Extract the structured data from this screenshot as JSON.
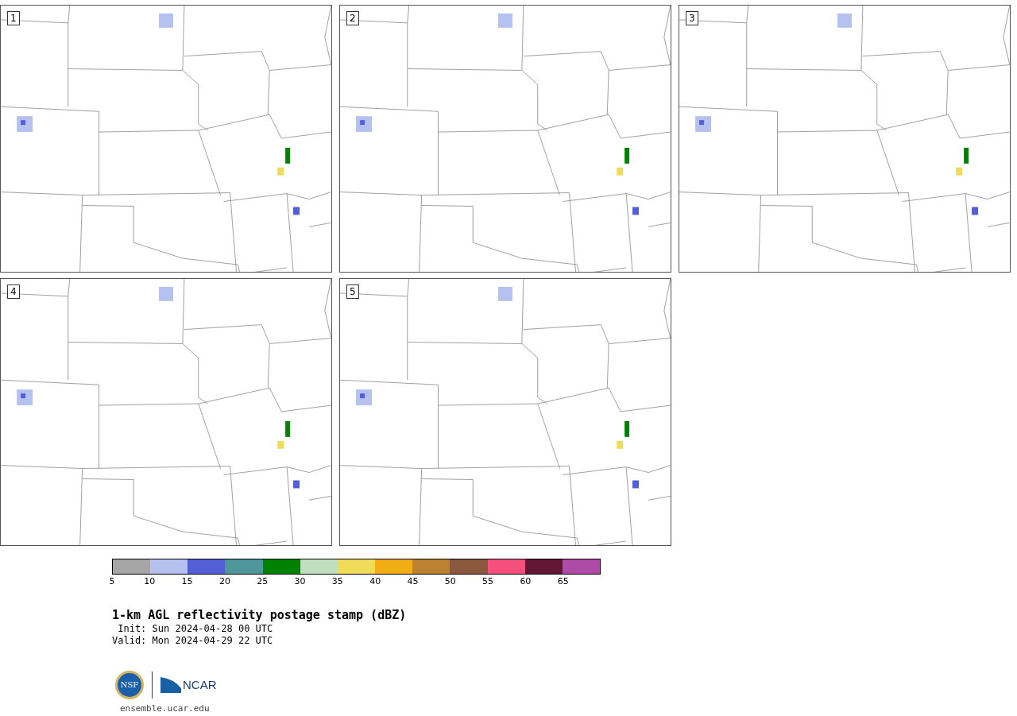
{
  "panels": [
    {
      "label": "1"
    },
    {
      "label": "2"
    },
    {
      "label": "3"
    },
    {
      "label": "4"
    },
    {
      "label": "5"
    }
  ],
  "colorbar": {
    "segments": [
      {
        "color": "#a6a6a6"
      },
      {
        "color": "#b5c1ef"
      },
      {
        "color": "#525fd6"
      },
      {
        "color": "#4f969b"
      },
      {
        "color": "#008200"
      },
      {
        "color": "#bfdfbf"
      },
      {
        "color": "#f0dc5a"
      },
      {
        "color": "#f0ae14"
      },
      {
        "color": "#bb8331"
      },
      {
        "color": "#8b5a3e"
      },
      {
        "color": "#f5507d"
      },
      {
        "color": "#611634"
      },
      {
        "color": "#ad4ba6"
      }
    ],
    "ticks": [
      "5",
      "10",
      "15",
      "20",
      "25",
      "30",
      "35",
      "40",
      "45",
      "50",
      "55",
      "60",
      "65"
    ]
  },
  "title": "1-km AGL reflectivity postage stamp (dBZ)",
  "init": " Init: Sun 2024-04-28 00 UTC",
  "valid": "Valid: Mon 2024-04-29 22 UTC",
  "logos": {
    "nsf": "NSF",
    "ncar": "NCAR"
  },
  "url": "ensemble.ucar.edu"
}
